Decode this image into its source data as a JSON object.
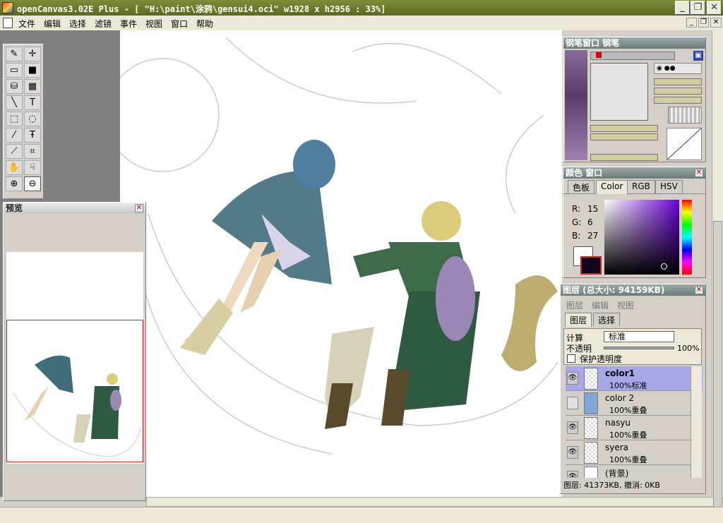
{
  "window": {
    "title": "openCanvas3.02E Plus - [ \"H:\\paint\\涂鸦\\gensui4.oci\" w1928 x h2956 : 33%]",
    "min": "_",
    "max": "❐",
    "close": "✕"
  },
  "menu": [
    "文件",
    "编辑",
    "选择",
    "滤镜",
    "事件",
    "视图",
    "窗口",
    "帮助"
  ],
  "mdi": {
    "min": "_",
    "restore": "❐",
    "close": "✕"
  },
  "tools": [
    {
      "name": "pen-tool-icon",
      "glyph": "✎"
    },
    {
      "name": "move-tool-icon",
      "glyph": "✛"
    },
    {
      "name": "rect-tool-icon",
      "glyph": "▭"
    },
    {
      "name": "fill-rect-tool-icon",
      "glyph": "■"
    },
    {
      "name": "bucket-tool-icon",
      "glyph": "⛁"
    },
    {
      "name": "gradient-tool-icon",
      "glyph": "▦"
    },
    {
      "name": "line-tool-icon",
      "glyph": "╲"
    },
    {
      "name": "text-tool-icon",
      "glyph": "T"
    },
    {
      "name": "rect-select-icon",
      "glyph": "⬚"
    },
    {
      "name": "lasso-select-icon",
      "glyph": "◌"
    },
    {
      "name": "magic-wand-icon",
      "glyph": "⁄"
    },
    {
      "name": "text-select-icon",
      "glyph": "Ŧ"
    },
    {
      "name": "eyedropper-icon",
      "glyph": "⟋"
    },
    {
      "name": "crop-tool-icon",
      "glyph": "⌗"
    },
    {
      "name": "hand-tool-icon",
      "glyph": "✋"
    },
    {
      "name": "rotate-hand-icon",
      "glyph": "☟"
    },
    {
      "name": "zoom-in-icon",
      "glyph": "⊕"
    },
    {
      "name": "zoom-out-icon",
      "glyph": "⊖"
    }
  ],
  "preview": {
    "title": "预览"
  },
  "pen": {
    "title": "钢笔窗口  钢笔"
  },
  "color": {
    "title": "颜色 窗口",
    "tabs": [
      "色板",
      "Color",
      "RGB",
      "HSV"
    ],
    "r_label": "R:",
    "r": "15",
    "g_label": "G:",
    "g": "6",
    "b_label": "B:",
    "b": "27",
    "current": "#0f061b"
  },
  "layers": {
    "title": "图层 (总大小: 94159KB)",
    "menu": [
      "图层",
      "编辑",
      "视图"
    ],
    "tabs": [
      "图层",
      "选择"
    ],
    "calc_label": "计算",
    "calc_value": "标准",
    "opacity_label": "不透明",
    "opacity_value": "100%",
    "protect_label": "保护透明度",
    "items": [
      {
        "name": "color1",
        "mode": "100%标准",
        "active": true
      },
      {
        "name": "color 2",
        "mode": "100%重叠",
        "active": false
      },
      {
        "name": "nasyu",
        "mode": "100%重叠",
        "active": false
      },
      {
        "name": "syera",
        "mode": "100%重叠",
        "active": false
      },
      {
        "name": "(背景)",
        "mode": "",
        "active": false
      }
    ],
    "status": "图层: 41373KB, 撤消: 0KB"
  }
}
